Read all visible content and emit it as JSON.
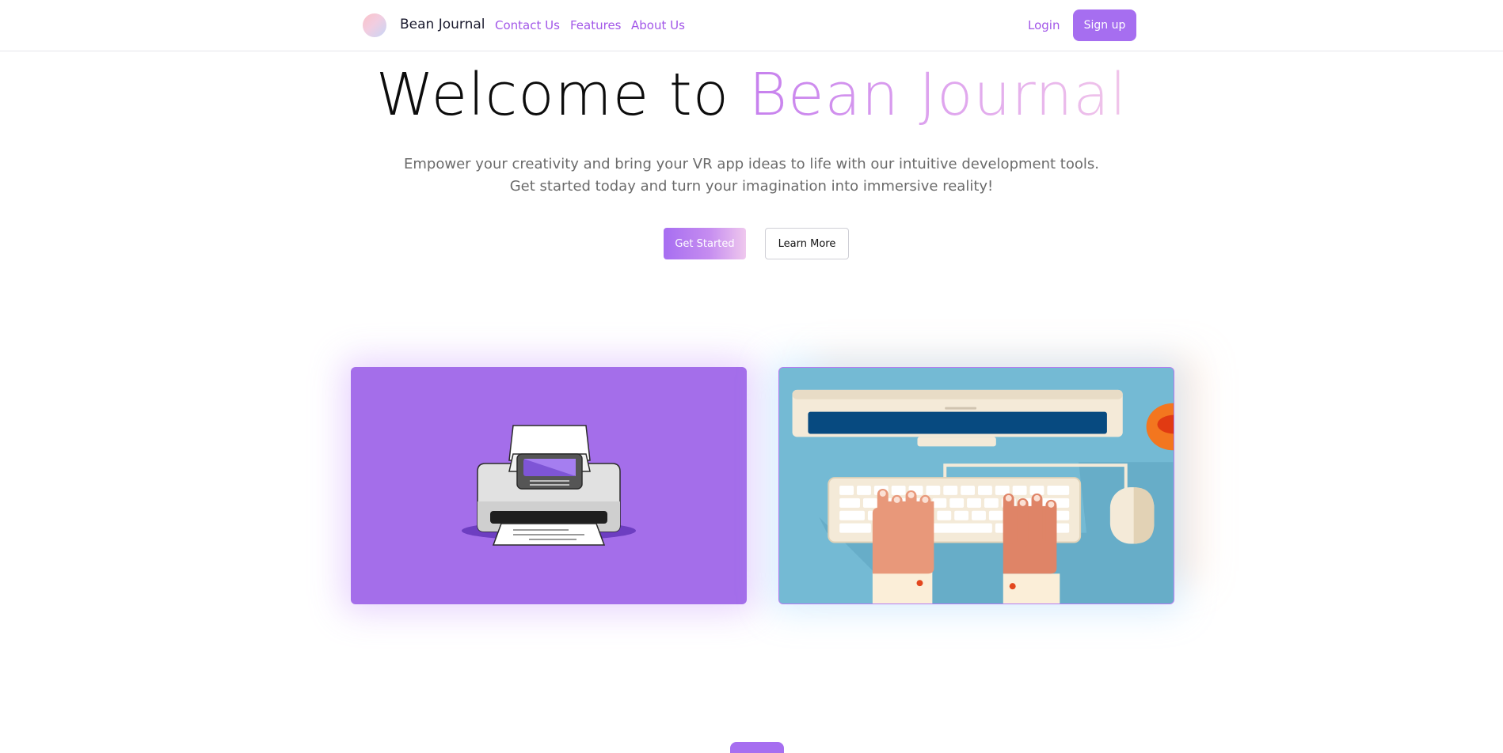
{
  "nav": {
    "brand": "Bean Journal",
    "links": [
      {
        "label": "Contact Us"
      },
      {
        "label": "Features"
      },
      {
        "label": "About Us"
      }
    ],
    "login_label": "Login",
    "signup_label": "Sign up"
  },
  "hero": {
    "title_plain": "Welcome to ",
    "title_accent": "Bean Journal",
    "subtitle": "Empower your creativity and bring your VR app ideas to life with our intuitive development tools. Get started today and turn your imagination into immersive reality!",
    "primary_button": "Get Started",
    "secondary_button": "Learn More"
  },
  "cards": [
    {
      "illustration": "printer-icon",
      "background": "#a46eea"
    },
    {
      "illustration": "keyboard-typing-illustration",
      "background": "#74bad4"
    }
  ],
  "colors": {
    "accent": "#a257e8",
    "button": "#a66ef0",
    "text_muted": "#6b6b6b"
  }
}
